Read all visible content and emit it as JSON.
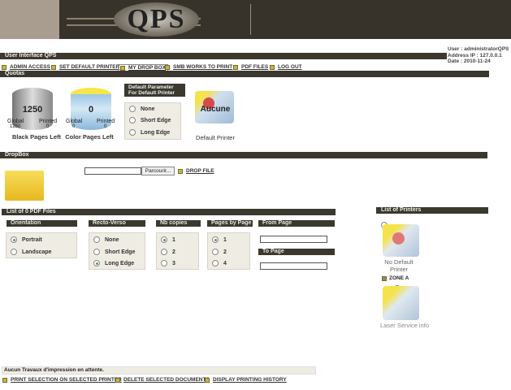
{
  "header": {
    "logo_text": "QPS"
  },
  "title_bar": "User Interface QPS",
  "user_info": {
    "user": "User : administratorQPS",
    "ip": "Address IP : 127.0.0.1",
    "date": "Date : 2010-11-24"
  },
  "nav": [
    "ADMIN ACCESS",
    "SET DEFAULT PRINTER",
    "MY DROP BOX",
    "SMB WORKS TO PRINT",
    "PDF FILES",
    "LOG OUT"
  ],
  "quotas": {
    "title": "Quotas",
    "black": {
      "value": "1250",
      "global_label": "Global",
      "printed_label": "Printed",
      "global": "1250",
      "printed": "0",
      "label": "Black Pages Left"
    },
    "color": {
      "value": "0",
      "global_label": "Global",
      "printed_label": "Printed",
      "global": "0",
      "printed": "0",
      "label": "Color Pages Left"
    },
    "default_param": {
      "title1": "Default Parameter",
      "title2": "For Default Printer",
      "options": [
        "None",
        "Short Edge",
        "Long Edge"
      ]
    },
    "default_printer": {
      "overlay": "Aucune",
      "label": "Default Printer"
    }
  },
  "dropbox": {
    "title": "DropBox",
    "browse": "Parcourir...",
    "drop": "DROP FILE",
    "file_value": ""
  },
  "pdf": {
    "title": "List of 0 PDF Files",
    "orientation": {
      "title": "Orientation",
      "options": [
        "Portrait",
        "Landscape"
      ]
    },
    "recto": {
      "title": "Recto-Verso",
      "options": [
        "None",
        "Short Edge",
        "Long Edge"
      ]
    },
    "copies": {
      "title": "Nb copies",
      "options": [
        "1",
        "2",
        "3"
      ]
    },
    "pages": {
      "title": "Pages by Page",
      "options": [
        "1",
        "2",
        "4"
      ]
    },
    "from": {
      "title": "From Page",
      "value": ""
    },
    "to": {
      "title": "To Page",
      "value": ""
    }
  },
  "printers": {
    "title": "List of Printers",
    "items": [
      {
        "label": "No Default Printer"
      },
      {
        "zone": "ZONE A"
      },
      {
        "label": "Laser Service info"
      }
    ]
  },
  "status": "Aucun Travaux d'impression en attente.",
  "actions": [
    "PRINT SELECTION ON SELECTED PRINTER",
    "DELETE SELECTED DOCUMENTS",
    "DISPLAY PRINTING HISTORY"
  ]
}
